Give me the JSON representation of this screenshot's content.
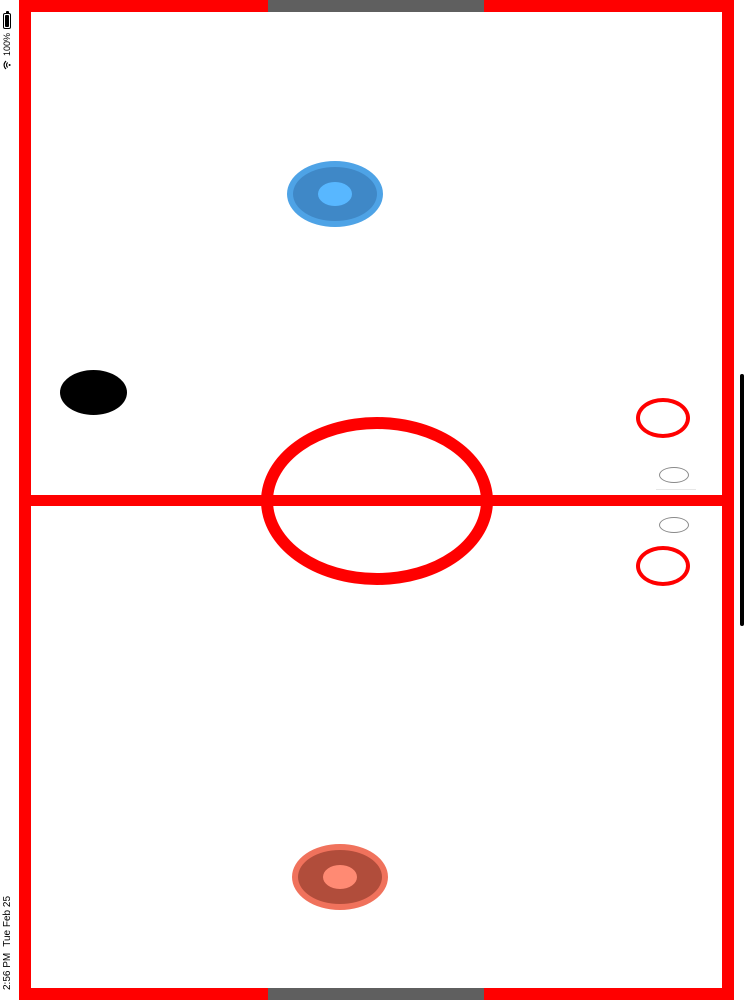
{
  "status_bar": {
    "time": "2:56 PM",
    "date": "Tue Feb 25",
    "battery_text": "100%",
    "battery_level": 1.0,
    "wifi_icon": "wifi-icon",
    "battery_icon": "battery-icon"
  },
  "colors": {
    "rink_border": "#ff0000",
    "rink_surface": "#ffffff",
    "goal": "#5f5f5f",
    "puck": "#000000",
    "player_top_outer": "#3f88c7",
    "player_top_ring": "#4ea3e6",
    "player_top_core": "#58b7ff",
    "player_bottom_outer": "#b14d3b",
    "player_bottom_ring": "#f0725c",
    "player_bottom_core": "#ff8a73",
    "score_ring": "#ff0000"
  },
  "game": {
    "top_player": "blue",
    "bottom_player": "red"
  }
}
